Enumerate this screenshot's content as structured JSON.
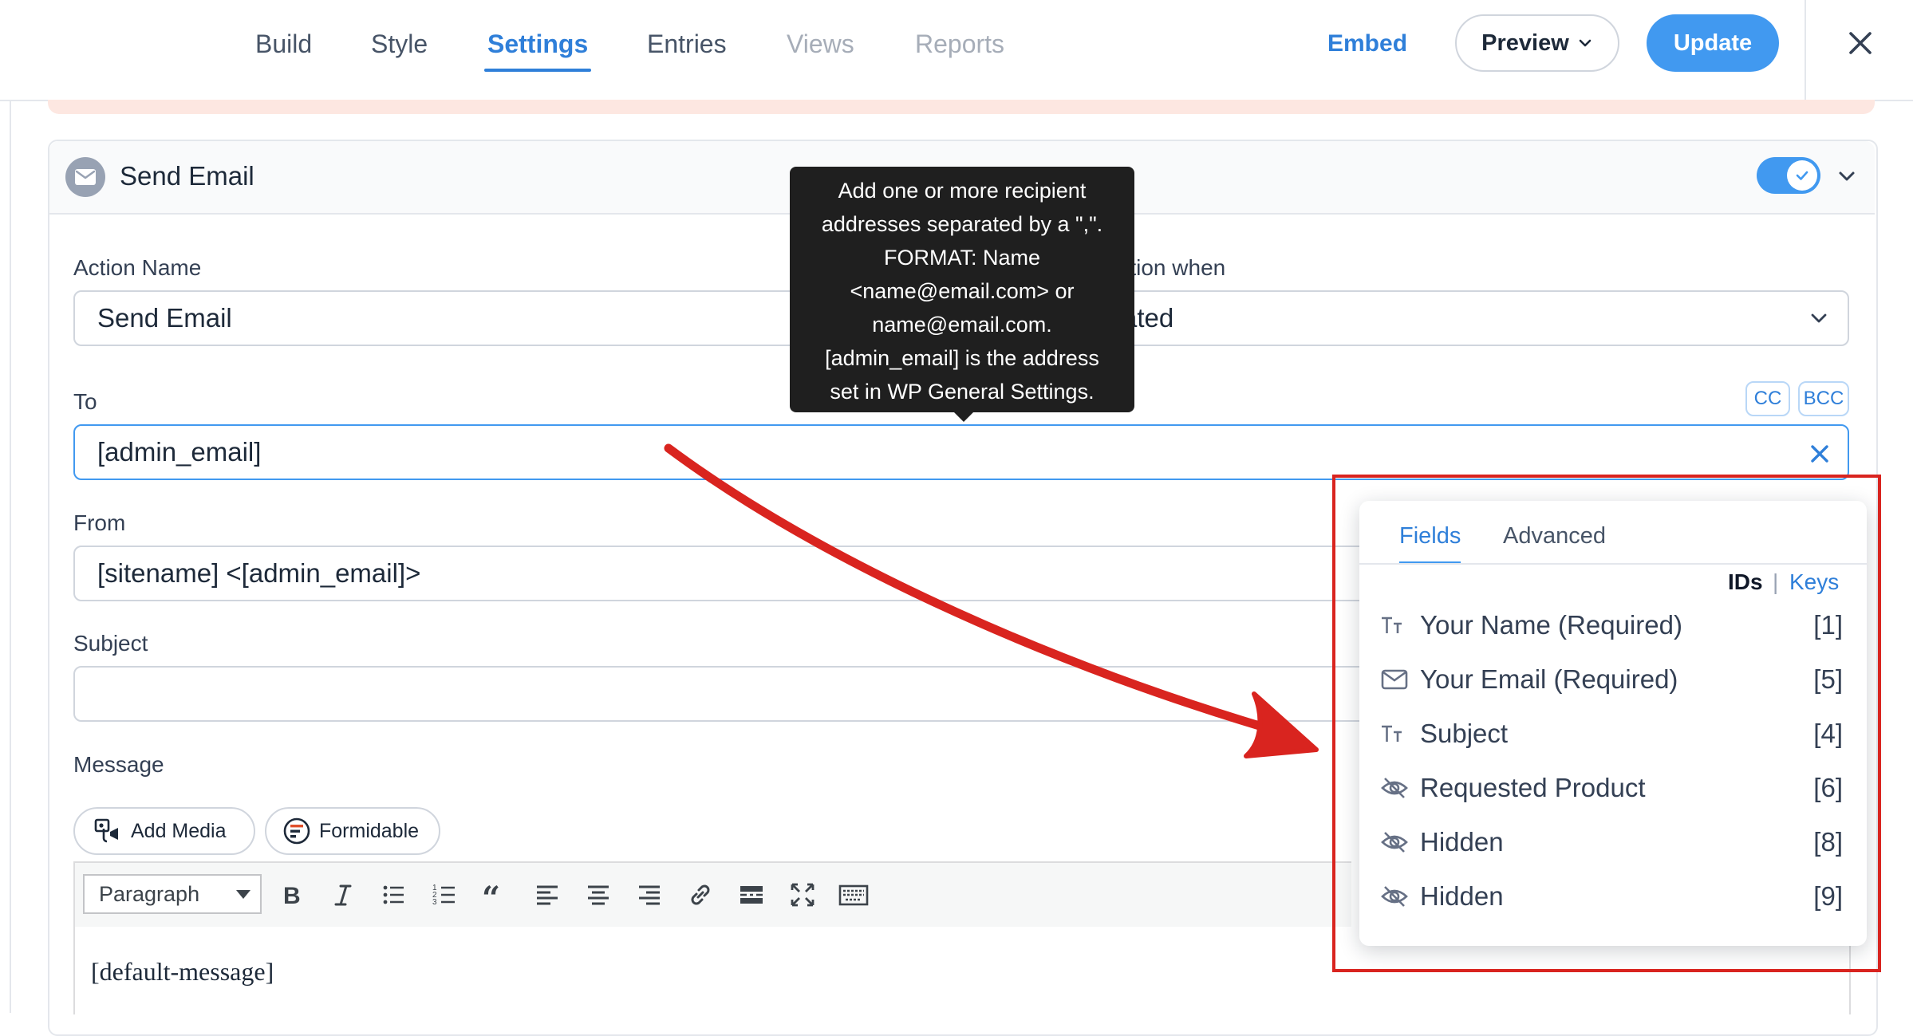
{
  "nav": {
    "tabs": [
      {
        "label": "Build"
      },
      {
        "label": "Style"
      },
      {
        "label": "Settings"
      },
      {
        "label": "Entries"
      },
      {
        "label": "Views"
      },
      {
        "label": "Reports"
      }
    ],
    "embed_label": "Embed",
    "preview_label": "Preview",
    "update_label": "Update"
  },
  "action": {
    "title": "Send Email",
    "enabled": true,
    "action_name_label": "Action Name",
    "action_name_value": "Send Email",
    "trigger_label": "Trigger this action when",
    "trigger_value": "Entry is created",
    "to_label": "To",
    "to_value": "[admin_email]",
    "cc_label": "CC",
    "bcc_label": "BCC",
    "from_label": "From",
    "from_value": "[sitename] <[admin_email]>",
    "subject_label": "Subject",
    "subject_value": "",
    "message_label": "Message",
    "add_media_label": "Add Media",
    "formidable_label": "Formidable",
    "paragraph_select": "Paragraph",
    "message_value": "[default-message]"
  },
  "tooltip": {
    "lines": [
      "Add one or more recipient",
      "addresses separated by a \",\".",
      "FORMAT: Name",
      "<name@email.com> or",
      "name@email.com.",
      "[admin_email] is the address",
      "set in WP General Settings."
    ]
  },
  "fields_popup": {
    "tabs": [
      {
        "label": "Fields"
      },
      {
        "label": "Advanced"
      }
    ],
    "ids_label": "IDs",
    "separator": "|",
    "keys_label": "Keys",
    "fields": [
      {
        "icon": "text-icon",
        "label": "Your Name (Required)",
        "id": "[1]"
      },
      {
        "icon": "envelope-icon",
        "label": "Your Email (Required)",
        "id": "[5]"
      },
      {
        "icon": "text-icon",
        "label": "Subject",
        "id": "[4]"
      },
      {
        "icon": "hidden-eye-icon",
        "label": "Requested Product",
        "id": "[6]"
      },
      {
        "icon": "hidden-eye-icon",
        "label": "Hidden",
        "id": "[8]"
      },
      {
        "icon": "hidden-eye-icon",
        "label": "Hidden",
        "id": "[9]"
      }
    ]
  },
  "colors": {
    "accent": "#4199f0",
    "annotation_red": "#d9241f",
    "tooltip_bg": "#1f1f1f"
  }
}
